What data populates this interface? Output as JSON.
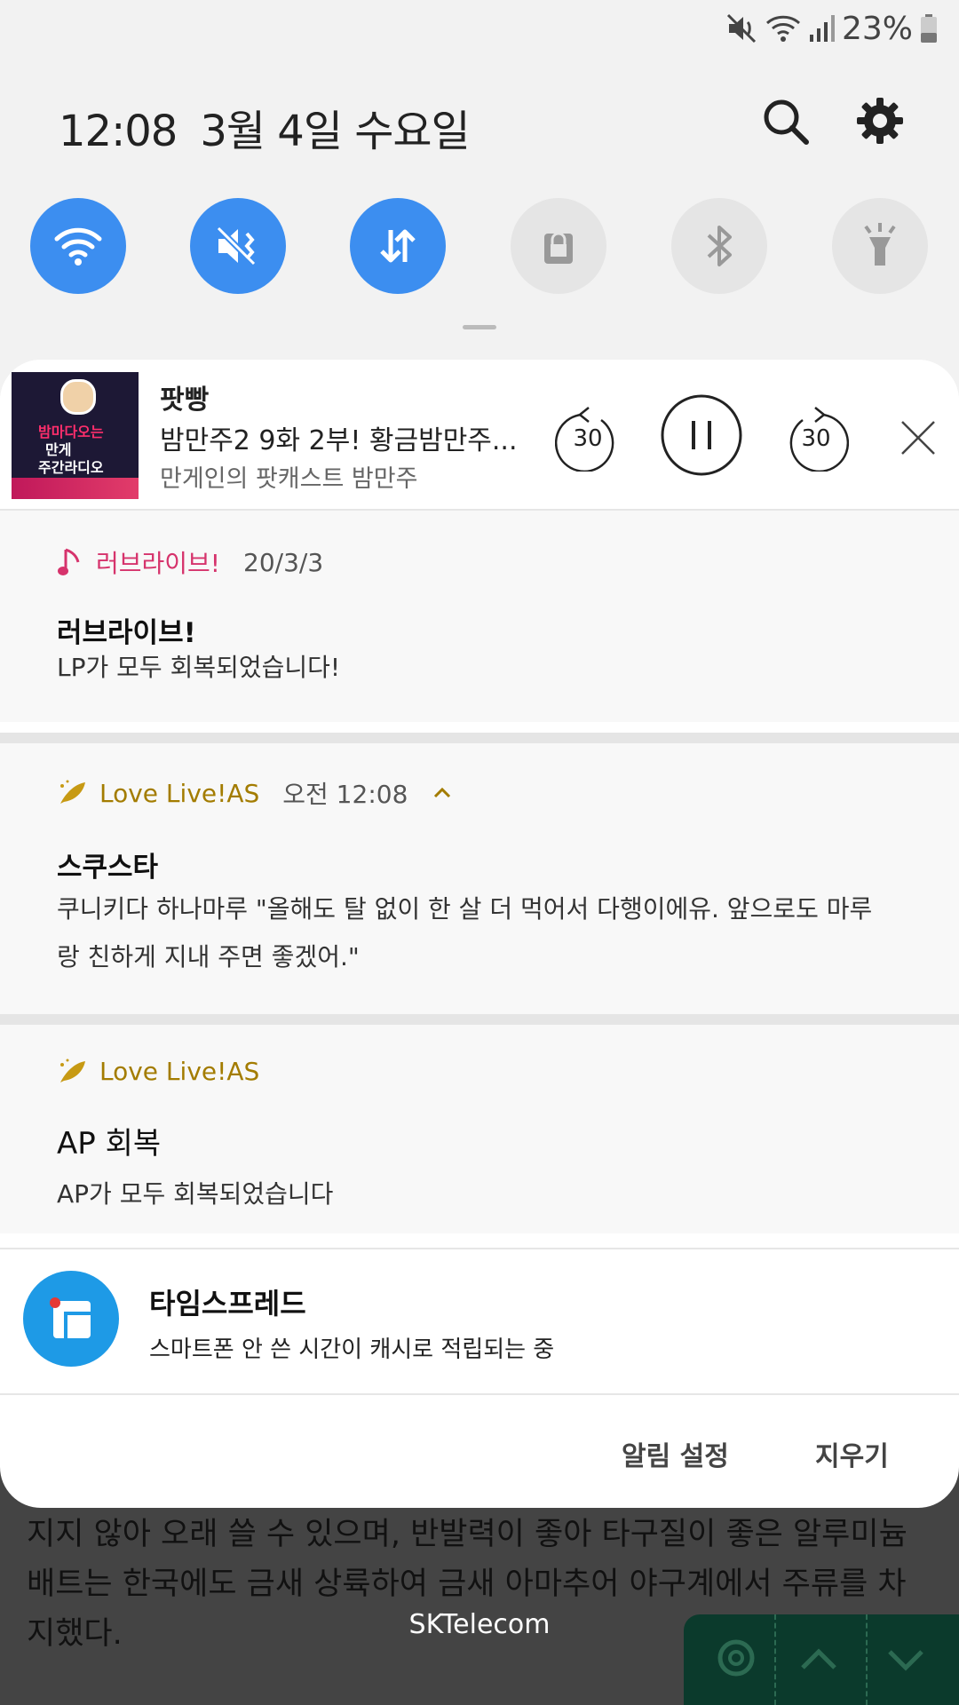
{
  "status_bar": {
    "battery_pct": "23%",
    "icons": [
      "mute-icon",
      "wifi-icon",
      "signal-icon",
      "battery-icon"
    ]
  },
  "header": {
    "time": "12:08",
    "date": "3월 4일 수요일"
  },
  "quick_toggles": [
    {
      "name": "wifi",
      "state": "on",
      "icon": "wifi-icon"
    },
    {
      "name": "mute",
      "state": "on",
      "icon": "mute-icon"
    },
    {
      "name": "mobile-data",
      "state": "on",
      "icon": "data-arrows-icon"
    },
    {
      "name": "screen-lock",
      "state": "off",
      "icon": "lock-icon"
    },
    {
      "name": "bluetooth",
      "state": "off",
      "icon": "bluetooth-icon"
    },
    {
      "name": "flashlight",
      "state": "off",
      "icon": "flashlight-icon"
    }
  ],
  "media": {
    "app": "팟빵",
    "title": "밤만주2 9화 2부! 황금밤만주...",
    "subtitle": "만게인의 팟캐스트 밤만주",
    "artwork_text": [
      "밤마다오는",
      "만게",
      "주간라디오"
    ],
    "rewind_label": "30",
    "forward_label": "30"
  },
  "notifications": [
    {
      "app": "러브라이브!",
      "time": "20/3/3",
      "title": "러브라이브!",
      "body": "LP가 모두 회복되었습니다!",
      "accent": "#d6336c"
    },
    {
      "app": "Love Live!AS",
      "time": "오전 12:08",
      "title": "스쿠스타",
      "body": "쿠니키다 하나마루 \"올해도 탈 없이 한 살 더 먹어서 다행이에유. 앞으로도 마루랑 친하게 지내 주면 좋겠어.\"",
      "accent": "#a37c00"
    },
    {
      "app": "Love Live!AS",
      "time": "",
      "title": "AP 회복",
      "body": "AP가 모두 회복되었습니다",
      "accent": "#a37c00"
    }
  ],
  "timespread": {
    "title": "타임스프레드",
    "text": "스마트폰 안 쓴 시간이 캐시로 적립되는 중"
  },
  "footer": {
    "settings_label": "알림 설정",
    "clear_label": "지우기"
  },
  "background": {
    "text": "지지 않아 오래 쓸 수 있으며, 반발력이 좋아 타구질이 좋은 알루미늄 배트는 한국에도 금새 상륙하여 금새 아마추어 야구계에서 주류를 차지했다.",
    "carrier": "SKTelecom"
  },
  "colors": {
    "toggle_on": "#3c8ef0",
    "toggle_off": "#e5e5e5",
    "panel_bg": "#f2f2f2"
  }
}
